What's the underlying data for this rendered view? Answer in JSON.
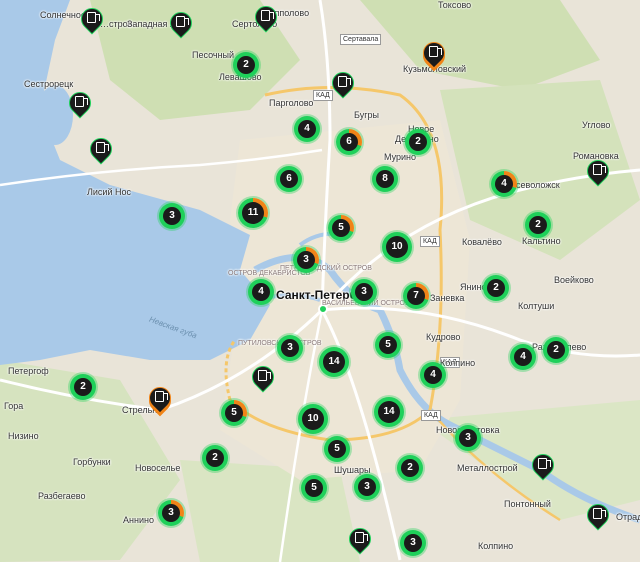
{
  "map": {
    "city": "Санкт-Петербург",
    "water_label": "Невская губа",
    "roads": [
      "Сертавала",
      "КАД",
      "КАД",
      "КАД",
      "КАД"
    ],
    "places": [
      {
        "id": "solnechnoe",
        "name": "Солнечное"
      },
      {
        "id": "sestroretsk-top",
        "name": "…стров"
      },
      {
        "id": "zapadnaya",
        "name": "Западная Ли…"
      },
      {
        "id": "sertolovo",
        "name": "Сертолово"
      },
      {
        "id": "luppolovo",
        "name": "Лупполово"
      },
      {
        "id": "toksovo",
        "name": "Токсово"
      },
      {
        "id": "pesochny",
        "name": "Песочный"
      },
      {
        "id": "levashovo",
        "name": "Левашово"
      },
      {
        "id": "kuzmolovsky",
        "name": "Кузьмоловский"
      },
      {
        "id": "sestroretsk",
        "name": "Сестрорецк"
      },
      {
        "id": "pargolovo",
        "name": "Парголово"
      },
      {
        "id": "bugry",
        "name": "Бугры"
      },
      {
        "id": "novoe",
        "name": "Новое"
      },
      {
        "id": "devyatkino",
        "name": "Девяткино"
      },
      {
        "id": "murino",
        "name": "Мурино"
      },
      {
        "id": "uglovo",
        "name": "Углово"
      },
      {
        "id": "romanovka",
        "name": "Романовка"
      },
      {
        "id": "vsevolozhsk",
        "name": "Всеволожск"
      },
      {
        "id": "lisiy-nos",
        "name": "Лисий Нос"
      },
      {
        "id": "kovalevo",
        "name": "Ковалёво"
      },
      {
        "id": "kaltino",
        "name": "Кальтино"
      },
      {
        "id": "voeykovo",
        "name": "Воейково"
      },
      {
        "id": "yanino",
        "name": "Янино-1"
      },
      {
        "id": "koltushi",
        "name": "Колтуши"
      },
      {
        "id": "zanevka",
        "name": "Заневка"
      },
      {
        "id": "razmetelevo",
        "name": "Разметелево"
      },
      {
        "id": "kudrovo",
        "name": "Кудрово"
      },
      {
        "id": "kolpino-west",
        "name": "Колпино"
      },
      {
        "id": "petergof",
        "name": "Петергоф"
      },
      {
        "id": "strelna",
        "name": "Стрельна"
      },
      {
        "id": "gora",
        "name": "Гора"
      },
      {
        "id": "nizino",
        "name": "Низино"
      },
      {
        "id": "gorbunki",
        "name": "Горбунки"
      },
      {
        "id": "novoselye",
        "name": "Новоселье"
      },
      {
        "id": "razbegaevo",
        "name": "Разбегаево"
      },
      {
        "id": "annino",
        "name": "Аннино"
      },
      {
        "id": "shushary",
        "name": "Шушары"
      },
      {
        "id": "novosaratovka",
        "name": "Новосаратовка"
      },
      {
        "id": "metallostroy",
        "name": "Металлострой"
      },
      {
        "id": "pontonny",
        "name": "Понтонный"
      },
      {
        "id": "otradnoe",
        "name": "Отрад…"
      },
      {
        "id": "kolpino",
        "name": "Колпино"
      }
    ],
    "districts": [
      {
        "id": "petrogradsky",
        "name": "ПЕТРОГРАДСКИЙ ОСТРОВ"
      },
      {
        "id": "dekabristov",
        "name": "ОСТРОВ ДЕКАБРИСТОВ"
      },
      {
        "id": "vasilyevsky",
        "name": "ВАСИЛЬЕВСКИЙ ОСТРОВ"
      },
      {
        "id": "putilovsky",
        "name": "ПУТИЛОВСКИЙ ОСТРОВ"
      }
    ],
    "clusters": [
      {
        "id": "levashovo",
        "count": "2",
        "accent": "green"
      },
      {
        "id": "pargolovo",
        "count": "4",
        "accent": "green"
      },
      {
        "id": "bugry",
        "count": "6",
        "accent": "orange"
      },
      {
        "id": "devyatkino",
        "count": "2",
        "accent": "green"
      },
      {
        "id": "ozerki",
        "count": "6",
        "accent": "green"
      },
      {
        "id": "murino-south",
        "count": "8",
        "accent": "green"
      },
      {
        "id": "vsevolozhsk",
        "count": "4",
        "accent": "orange"
      },
      {
        "id": "lakhta",
        "count": "3",
        "accent": "green"
      },
      {
        "id": "primorsky",
        "count": "11",
        "accent": "orange"
      },
      {
        "id": "udelnaya",
        "count": "5",
        "accent": "orange"
      },
      {
        "id": "kaltino",
        "count": "2",
        "accent": "green"
      },
      {
        "id": "krasnogvardeysky",
        "count": "10",
        "accent": "green"
      },
      {
        "id": "petrogradsky",
        "count": "3",
        "accent": "orange"
      },
      {
        "id": "yanino",
        "count": "2",
        "accent": "green"
      },
      {
        "id": "vasilyevsky",
        "count": "4",
        "accent": "green"
      },
      {
        "id": "center",
        "count": "3",
        "accent": "green"
      },
      {
        "id": "zanevka",
        "count": "7",
        "accent": "orange"
      },
      {
        "id": "kudrovo",
        "count": "5",
        "accent": "green"
      },
      {
        "id": "razmetelevo",
        "count": "2",
        "accent": "green"
      },
      {
        "id": "koltushi-south",
        "count": "4",
        "accent": "green"
      },
      {
        "id": "putilovsky",
        "count": "3",
        "accent": "green"
      },
      {
        "id": "moskovsky",
        "count": "14",
        "accent": "green"
      },
      {
        "id": "dybenko",
        "count": "4",
        "accent": "green"
      },
      {
        "id": "petergof",
        "count": "2",
        "accent": "green"
      },
      {
        "id": "krasnoselsky",
        "count": "5",
        "accent": "orange"
      },
      {
        "id": "frunzensky",
        "count": "14",
        "accent": "green"
      },
      {
        "id": "kupchino",
        "count": "10",
        "accent": "green"
      },
      {
        "id": "novosaratovka",
        "count": "3",
        "accent": "green"
      },
      {
        "id": "pulkovo",
        "count": "5",
        "accent": "green"
      },
      {
        "id": "novoselye",
        "count": "2",
        "accent": "green"
      },
      {
        "id": "shushary-east",
        "count": "2",
        "accent": "green"
      },
      {
        "id": "shushary",
        "count": "3",
        "accent": "green"
      },
      {
        "id": "pushkin-north",
        "count": "5",
        "accent": "green"
      },
      {
        "id": "annino",
        "count": "3",
        "accent": "orange"
      },
      {
        "id": "kolpino",
        "count": "3",
        "accent": "green"
      }
    ],
    "pins": [
      {
        "id": "solnechnoe-pin",
        "accent": "green"
      },
      {
        "id": "zapadnaya-pin",
        "accent": "green"
      },
      {
        "id": "sertolovo-pin",
        "accent": "green"
      },
      {
        "id": "kuzmolovsky-pin",
        "accent": "orange"
      },
      {
        "id": "sestroretsk-pin",
        "accent": "green"
      },
      {
        "id": "lisiy-nos-pin",
        "accent": "green"
      },
      {
        "id": "bugry-pin",
        "accent": "green"
      },
      {
        "id": "vsevolozhsk-pin",
        "accent": "green"
      },
      {
        "id": "strelna-pin",
        "accent": "orange"
      },
      {
        "id": "ligovo-pin",
        "accent": "green"
      },
      {
        "id": "metallostroy-pin",
        "accent": "green"
      },
      {
        "id": "otradnoe-pin",
        "accent": "green"
      },
      {
        "id": "pushkin-pin",
        "accent": "green"
      }
    ],
    "colors": {
      "cluster": "#1fd05a",
      "accent": "#f08418",
      "water": "#a9c9e8",
      "marker": "#1b1b1b"
    }
  }
}
